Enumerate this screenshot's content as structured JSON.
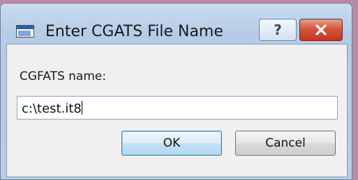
{
  "dialog": {
    "title": "Enter CGATS File Name",
    "help_symbol": "?",
    "close_symbol": "✕",
    "field_label": "CGFATS name:",
    "field_value": "c:\\test.it8",
    "ok_label": "OK",
    "cancel_label": "Cancel"
  },
  "icons": {
    "app": "window-app-icon",
    "help": "help-icon",
    "close": "close-icon"
  },
  "colors": {
    "titlebar": "#b8cde6",
    "close_button": "#c9452c",
    "ok_border": "#3c7fb1"
  }
}
